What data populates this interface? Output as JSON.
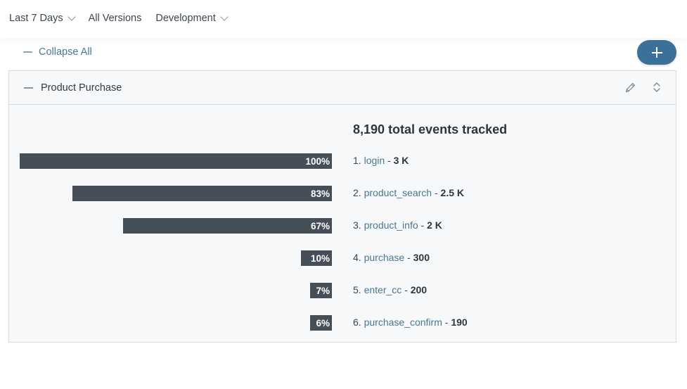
{
  "filters": {
    "date_range": "Last 7 Days",
    "versions": "All Versions",
    "environment": "Development"
  },
  "toolbar": {
    "collapse_all_label": "Collapse All",
    "add_button_icon": "plus-icon"
  },
  "funnel": {
    "title": "Product Purchase",
    "total_label": "8,190 total events tracked",
    "steps": [
      {
        "index": "1.",
        "event": "login",
        "sep": "-",
        "count": "3 K",
        "percent_label": "100%",
        "percent": 100
      },
      {
        "index": "2.",
        "event": "product_search",
        "sep": "-",
        "count": "2.5 K",
        "percent_label": "83%",
        "percent": 83
      },
      {
        "index": "3.",
        "event": "product_info",
        "sep": "-",
        "count": "2 K",
        "percent_label": "67%",
        "percent": 67
      },
      {
        "index": "4.",
        "event": "purchase",
        "sep": "-",
        "count": "300",
        "percent_label": "10%",
        "percent": 10
      },
      {
        "index": "5.",
        "event": "enter_cc",
        "sep": "-",
        "count": "200",
        "percent_label": "7%",
        "percent": 7
      },
      {
        "index": "6.",
        "event": "purchase_confirm",
        "sep": "-",
        "count": "190",
        "percent_label": "6%",
        "percent": 6
      }
    ]
  },
  "colors": {
    "bar": "#464e57",
    "link": "#4a7793",
    "accent_button": "#3b7099"
  }
}
